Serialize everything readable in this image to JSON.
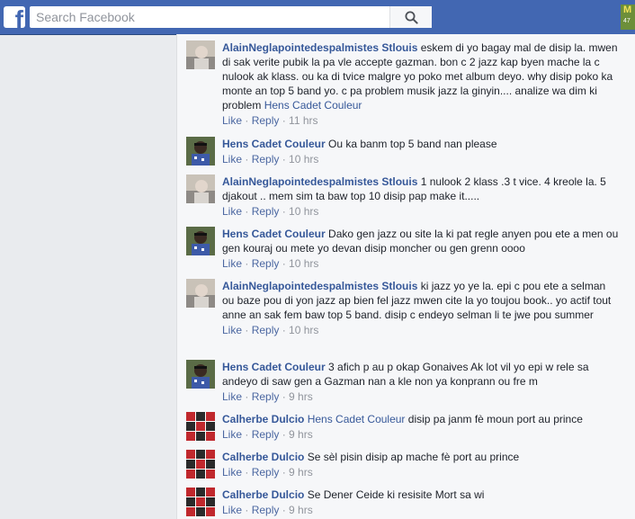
{
  "header": {
    "search_placeholder": "Search Facebook",
    "logo": "f",
    "corner_top": "M",
    "corner_bottom": "47"
  },
  "comments": [
    {
      "author": "AlainNeglapointedespalmistes Stlouis",
      "text": "eskem di yo bagay mal de disip la. mwen di sak verite pubik la pa vle accepte gazman. bon c 2 jazz kap byen mache la c nulook ak klass. ou ka di tvice malgre yo poko met album deyo. why disip poko ka monte an top 5 band yo. c pa problem musik jazz la ginyin.... analize wa dim ki problem",
      "mention": "Hens Cadet Couleur",
      "like": "Like",
      "reply": "Reply",
      "time": "11 hrs"
    },
    {
      "author": "Hens Cadet Couleur",
      "text": "Ou ka banm top 5 band nan please",
      "mention": "",
      "like": "Like",
      "reply": "Reply",
      "time": "10 hrs"
    },
    {
      "author": "AlainNeglapointedespalmistes Stlouis",
      "text": "1 nulook 2 klass .3 t vice. 4 kreole la. 5 djakout .. mem sim ta baw top 10 disip pap make it.....",
      "mention": "",
      "like": "Like",
      "reply": "Reply",
      "time": "10 hrs"
    },
    {
      "author": "Hens Cadet Couleur",
      "text": "Dako gen jazz ou site la ki pat regle anyen pou ete a men ou gen kouraj ou mete yo devan disip moncher ou gen grenn oooo",
      "mention": "",
      "like": "Like",
      "reply": "Reply",
      "time": "10 hrs"
    },
    {
      "author": "AlainNeglapointedespalmistes Stlouis",
      "text": "ki jazz yo ye la. epi c pou ete a selman ou baze pou di yon jazz ap bien fel jazz mwen cite la yo toujou book.. yo actif tout anne an sak fem baw top 5 band. disip c endeyo selman li te jwe pou summer",
      "mention": "",
      "like": "Like",
      "reply": "Reply",
      "time": "10 hrs"
    },
    {
      "author": "Hens Cadet Couleur",
      "text": "3 afich p au p okap Gonaives Ak lot vil yo epi w rele sa andeyo di saw gen a Gazman nan a kle non ya konprann ou fre m",
      "mention": "",
      "like": "Like",
      "reply": "Reply",
      "time": "9 hrs"
    },
    {
      "author": "Calherbe Dulcio",
      "text": "disip pa janm fè moun port au prince",
      "mention": "Hens Cadet Couleur",
      "like": "Like",
      "reply": "Reply",
      "time": "9 hrs"
    },
    {
      "author": "Calherbe Dulcio",
      "text": "Se sèl pisin disip ap mache fè port au prince",
      "mention": "",
      "like": "Like",
      "reply": "Reply",
      "time": "9 hrs"
    },
    {
      "author": "Calherbe Dulcio",
      "text": "Se Dener Ceide ki resisite Mort sa wi",
      "mention": "",
      "like": "Like",
      "reply": "Reply",
      "time": "9 hrs"
    }
  ],
  "colors": {
    "topbar": "#4267b2",
    "link": "#365899",
    "meta": "#90949c",
    "panel": "#f6f7f9"
  },
  "icons": [
    "facebook-logo-icon",
    "search-icon",
    "avatar-alain",
    "avatar-hens",
    "avatar-calherbe"
  ]
}
